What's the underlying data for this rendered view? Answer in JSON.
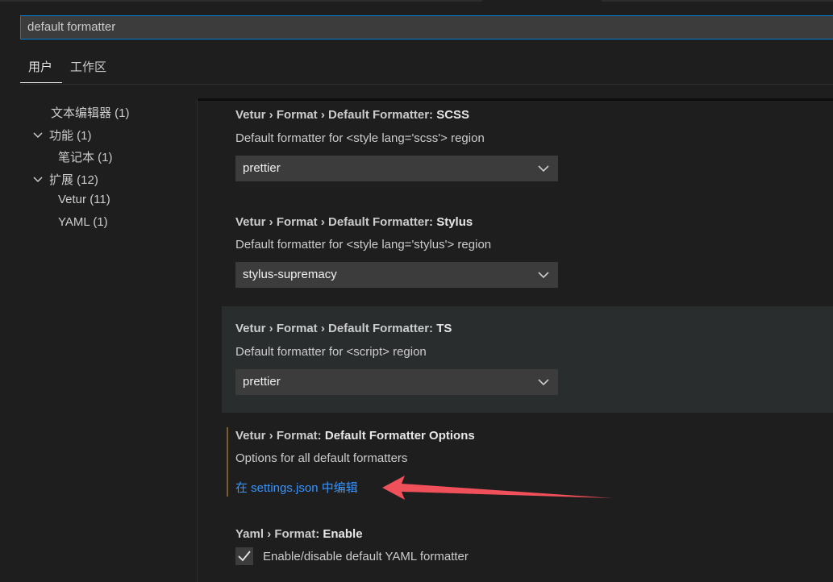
{
  "search": {
    "value": "default formatter"
  },
  "tabs": [
    {
      "label": "用户",
      "active": true
    },
    {
      "label": "工作区",
      "active": false
    }
  ],
  "toc": [
    {
      "label": "文本编辑器 (1)",
      "expandable": false
    },
    {
      "label": "功能 (1)",
      "expandable": true,
      "icon": "chevron-down-icon"
    },
    {
      "label": "笔记本 (1)",
      "expandable": false
    },
    {
      "label": "扩展 (12)",
      "expandable": true,
      "icon": "chevron-down-icon"
    },
    {
      "label": "Vetur (11)",
      "expandable": false
    },
    {
      "label": "YAML (1)",
      "expandable": false
    }
  ],
  "settings": [
    {
      "category": "Vetur › Format › Default Formatter: ",
      "name": "SCSS",
      "description": "Default formatter for <style lang='scss'> region",
      "value": "prettier"
    },
    {
      "category": "Vetur › Format › Default Formatter: ",
      "name": "Stylus",
      "description": "Default formatter for <style lang='stylus'> region",
      "value": "stylus-supremacy"
    },
    {
      "category": "Vetur › Format › Default Formatter: ",
      "name": "TS",
      "description": "Default formatter for <script> region",
      "value": "prettier"
    },
    {
      "category": "Vetur › Format: ",
      "name": "Default Formatter Options",
      "description": "Options for all default formatters",
      "link": "在 settings.json 中编辑"
    },
    {
      "category": "Yaml › Format: ",
      "name": "Enable",
      "checkbox_label": "Enable/disable default YAML formatter",
      "checked": true
    }
  ],
  "colors": {
    "background": "#1e1e1e",
    "accent_border": "#007fd4",
    "link": "#3794ff",
    "annotation_arrow": "#f0505a",
    "modified_indicator": "#7a5c2e"
  }
}
